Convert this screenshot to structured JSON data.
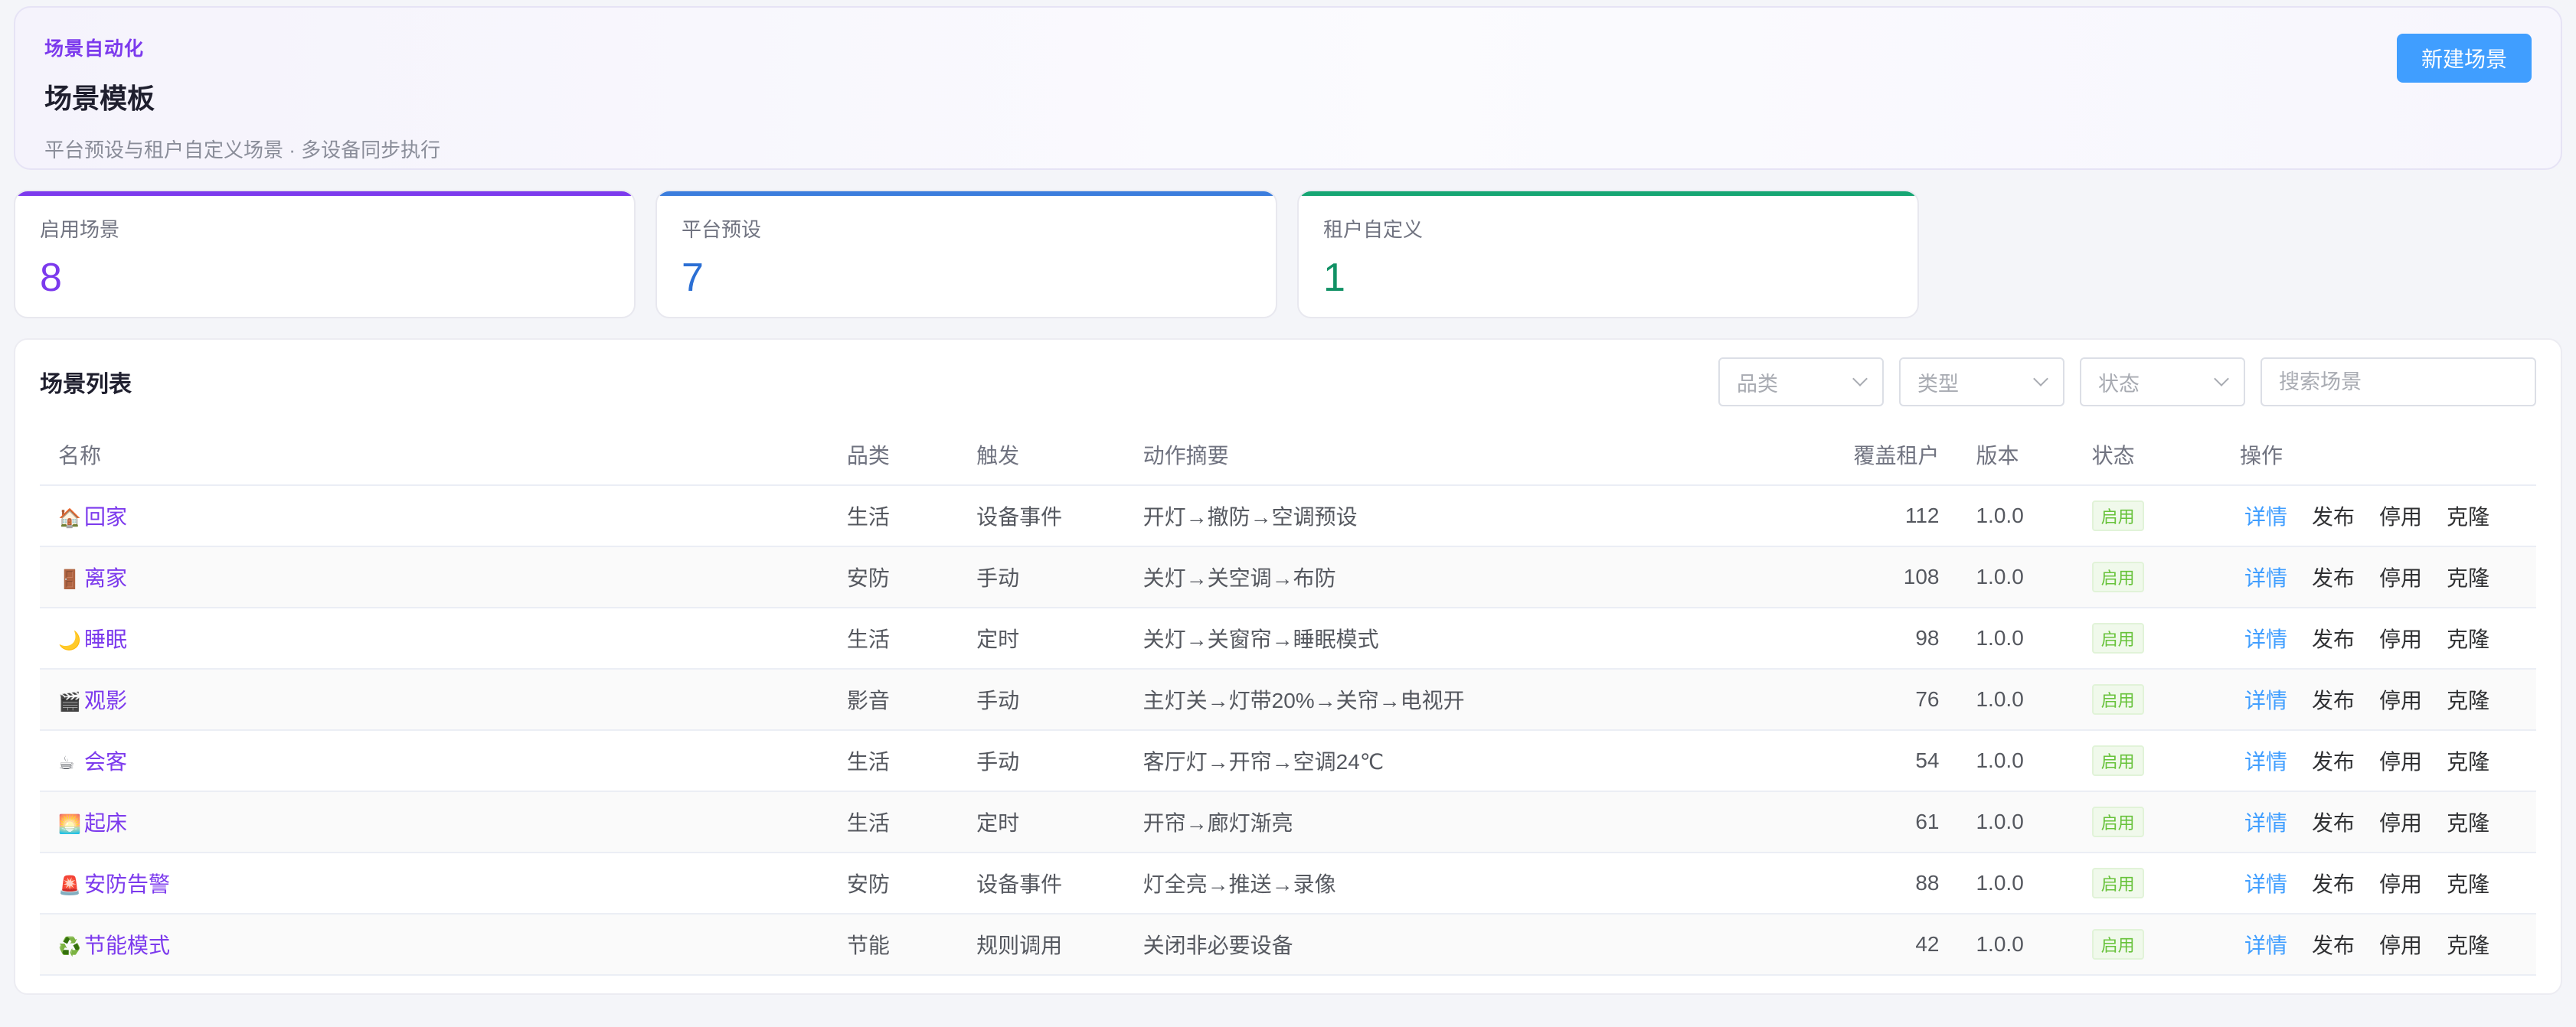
{
  "header": {
    "eyebrow": "场景自动化",
    "title": "场景模板",
    "subtitle": "平台预设与租户自定义场景 · 多设备同步执行",
    "new_button": "新建场景"
  },
  "stats": [
    {
      "label": "启用场景",
      "value": "8"
    },
    {
      "label": "平台预设",
      "value": "7"
    },
    {
      "label": "租户自定义",
      "value": "1"
    }
  ],
  "list": {
    "title": "场景列表",
    "filters": {
      "category": "品类",
      "type": "类型",
      "status": "状态"
    },
    "search_placeholder": "搜索场景",
    "columns": [
      "名称",
      "品类",
      "触发",
      "动作摘要",
      "覆盖租户",
      "版本",
      "状态",
      "操作"
    ],
    "operations": {
      "detail": "详情",
      "publish": "发布",
      "disable": "停用",
      "clone": "克隆"
    },
    "rows": [
      {
        "icon": "🏠",
        "name": "回家",
        "category": "生活",
        "trigger": "设备事件",
        "action": "开灯→撤防→空调预设",
        "tenants": "112",
        "version": "1.0.0",
        "status": "启用"
      },
      {
        "icon": "🚪",
        "name": "离家",
        "category": "安防",
        "trigger": "手动",
        "action": "关灯→关空调→布防",
        "tenants": "108",
        "version": "1.0.0",
        "status": "启用"
      },
      {
        "icon": "🌙",
        "name": "睡眠",
        "category": "生活",
        "trigger": "定时",
        "action": "关灯→关窗帘→睡眠模式",
        "tenants": "98",
        "version": "1.0.0",
        "status": "启用"
      },
      {
        "icon": "🎬",
        "name": "观影",
        "category": "影音",
        "trigger": "手动",
        "action": "主灯关→灯带20%→关帘→电视开",
        "tenants": "76",
        "version": "1.0.0",
        "status": "启用"
      },
      {
        "icon": "☕",
        "name": "会客",
        "category": "生活",
        "trigger": "手动",
        "action": "客厅灯→开帘→空调24℃",
        "tenants": "54",
        "version": "1.0.0",
        "status": "启用"
      },
      {
        "icon": "🌅",
        "name": "起床",
        "category": "生活",
        "trigger": "定时",
        "action": "开帘→廊灯渐亮",
        "tenants": "61",
        "version": "1.0.0",
        "status": "启用"
      },
      {
        "icon": "🚨",
        "name": "安防告警",
        "category": "安防",
        "trigger": "设备事件",
        "action": "灯全亮→推送→录像",
        "tenants": "88",
        "version": "1.0.0",
        "status": "启用"
      },
      {
        "icon": "♻️",
        "name": "节能模式",
        "category": "节能",
        "trigger": "规则调用",
        "action": "关闭非必要设备",
        "tenants": "42",
        "version": "1.0.0",
        "status": "启用"
      }
    ]
  },
  "colors": {
    "accent": "#7c3aed",
    "primary": "#409eff",
    "success": "#67c23a"
  }
}
